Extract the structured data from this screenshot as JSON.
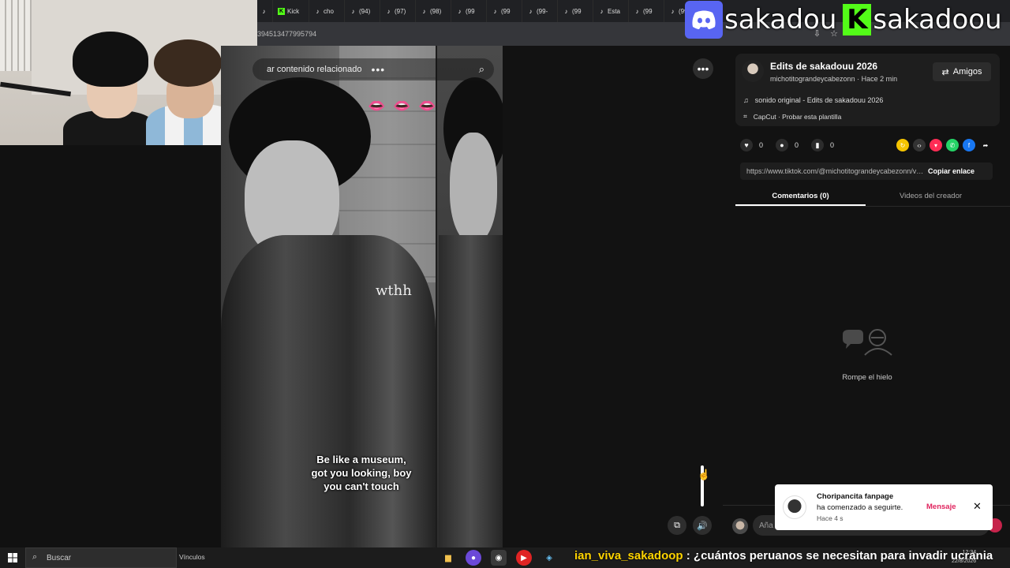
{
  "browser": {
    "tabs": [
      {
        "icon": "tiktok-icon",
        "label": ""
      },
      {
        "icon": "kick-icon",
        "label": "Kick"
      },
      {
        "icon": "tiktok-icon",
        "label": "cho"
      },
      {
        "icon": "tiktok-icon",
        "label": "(94)"
      },
      {
        "icon": "tiktok-icon",
        "label": "(97)"
      },
      {
        "icon": "tiktok-icon",
        "label": "(98)"
      },
      {
        "icon": "tiktok-icon",
        "label": "(99"
      },
      {
        "icon": "tiktok-icon",
        "label": "(99"
      },
      {
        "icon": "tiktok-icon",
        "label": "(99-"
      },
      {
        "icon": "tiktok-icon",
        "label": "(99"
      },
      {
        "icon": "tiktok-icon",
        "label": "Esta"
      },
      {
        "icon": "tiktok-icon",
        "label": "(99"
      },
      {
        "icon": "tiktok-icon",
        "label": "(99"
      }
    ],
    "url_fragment": "3945134779957​94"
  },
  "overlay": {
    "discord_name": "sakadou",
    "kick_letter": "K",
    "kick_name": "sakadoou"
  },
  "video": {
    "search_placeholder": "ar contenido relacionado",
    "overlay_word": "wthh",
    "lyrics": [
      "Be like a museum,",
      "got you looking, boy",
      "you can't touch"
    ]
  },
  "sidebar": {
    "title": "Edits de sakadouu 2026",
    "subtitle": "michotitograndeycabezonn · Hace 2 min",
    "friends_label": "Amigos",
    "sound_label": "sonido original - Edits de sakadouu 2026",
    "capcut_label": "CapCut · Probar esta plantilla",
    "likes": "0",
    "comments": "0",
    "saves": "0",
    "link": "https://www.tiktok.com/@michotitograndeycabezonn/video/",
    "copy_label": "Copiar enlace",
    "tab_comments": "Comentarios (0)",
    "tab_videos": "Videos del creador",
    "empty_text": "Rompe el hielo",
    "comment_placeholder": "Aña"
  },
  "toast": {
    "name": "Choripancita fanpage",
    "action": "ha comenzado a seguirte.",
    "time": "Hace 4 s",
    "message_label": "Mensaje"
  },
  "taskbar": {
    "search_label": "Buscar",
    "links_label": "Vínculos",
    "chat_user": "ian_viva_sakadoop",
    "chat_message": " : ¿cuántos peruanos se necesitan para invadir ucrania",
    "time": "12:34",
    "date": "22/8/2026"
  },
  "colors": {
    "discord": "#5865f2",
    "kick": "#53fc18",
    "tiktok_red": "#e0245e"
  }
}
